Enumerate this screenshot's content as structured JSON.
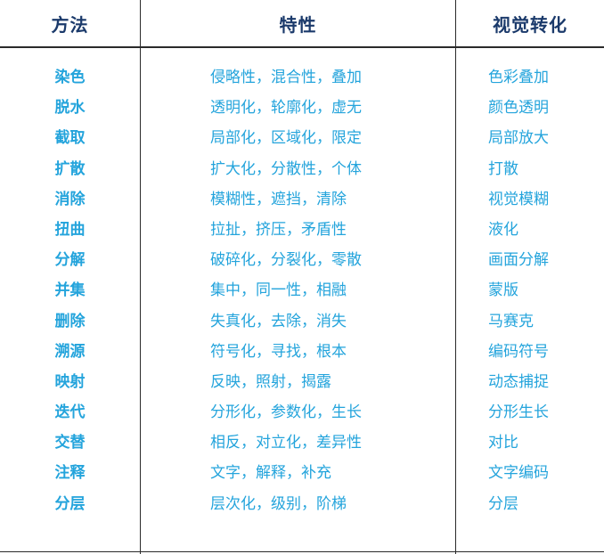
{
  "headers": {
    "method": "方法",
    "properties": "特性",
    "visual": "视觉转化"
  },
  "rows": [
    {
      "method": "染色",
      "properties": "侵略性，混合性，叠加",
      "visual": "色彩叠加"
    },
    {
      "method": "脱水",
      "properties": "透明化，轮廓化，虚无",
      "visual": "颜色透明"
    },
    {
      "method": "截取",
      "properties": "局部化，区域化，限定",
      "visual": "局部放大"
    },
    {
      "method": "扩散",
      "properties": "扩大化，分散性，个体",
      "visual": "打散"
    },
    {
      "method": "消除",
      "properties": "模糊性，遮挡，清除",
      "visual": "视觉模糊"
    },
    {
      "method": "扭曲",
      "properties": "拉扯，挤压，矛盾性",
      "visual": "液化"
    },
    {
      "method": "分解",
      "properties": "破碎化，分裂化，零散",
      "visual": "画面分解"
    },
    {
      "method": "并集",
      "properties": "集中，同一性，相融",
      "visual": "蒙版"
    },
    {
      "method": "删除",
      "properties": "失真化，去除，消失",
      "visual": "马赛克"
    },
    {
      "method": "溯源",
      "properties": "符号化，寻找，根本",
      "visual": "编码符号"
    },
    {
      "method": "映射",
      "properties": "反映，照射，揭露",
      "visual": "动态捕捉"
    },
    {
      "method": "迭代",
      "properties": "分形化，参数化，生长",
      "visual": "分形生长"
    },
    {
      "method": "交替",
      "properties": "相反，对立化，差异性",
      "visual": "对比"
    },
    {
      "method": "注释",
      "properties": "文字，解释，补充",
      "visual": "文字编码"
    },
    {
      "method": "分层",
      "properties": "层次化，级别，阶梯",
      "visual": "分层"
    }
  ],
  "colors": {
    "header_text": "#1b3a6b",
    "body_text": "#24a4dc",
    "rule": "#2a2a2a"
  }
}
